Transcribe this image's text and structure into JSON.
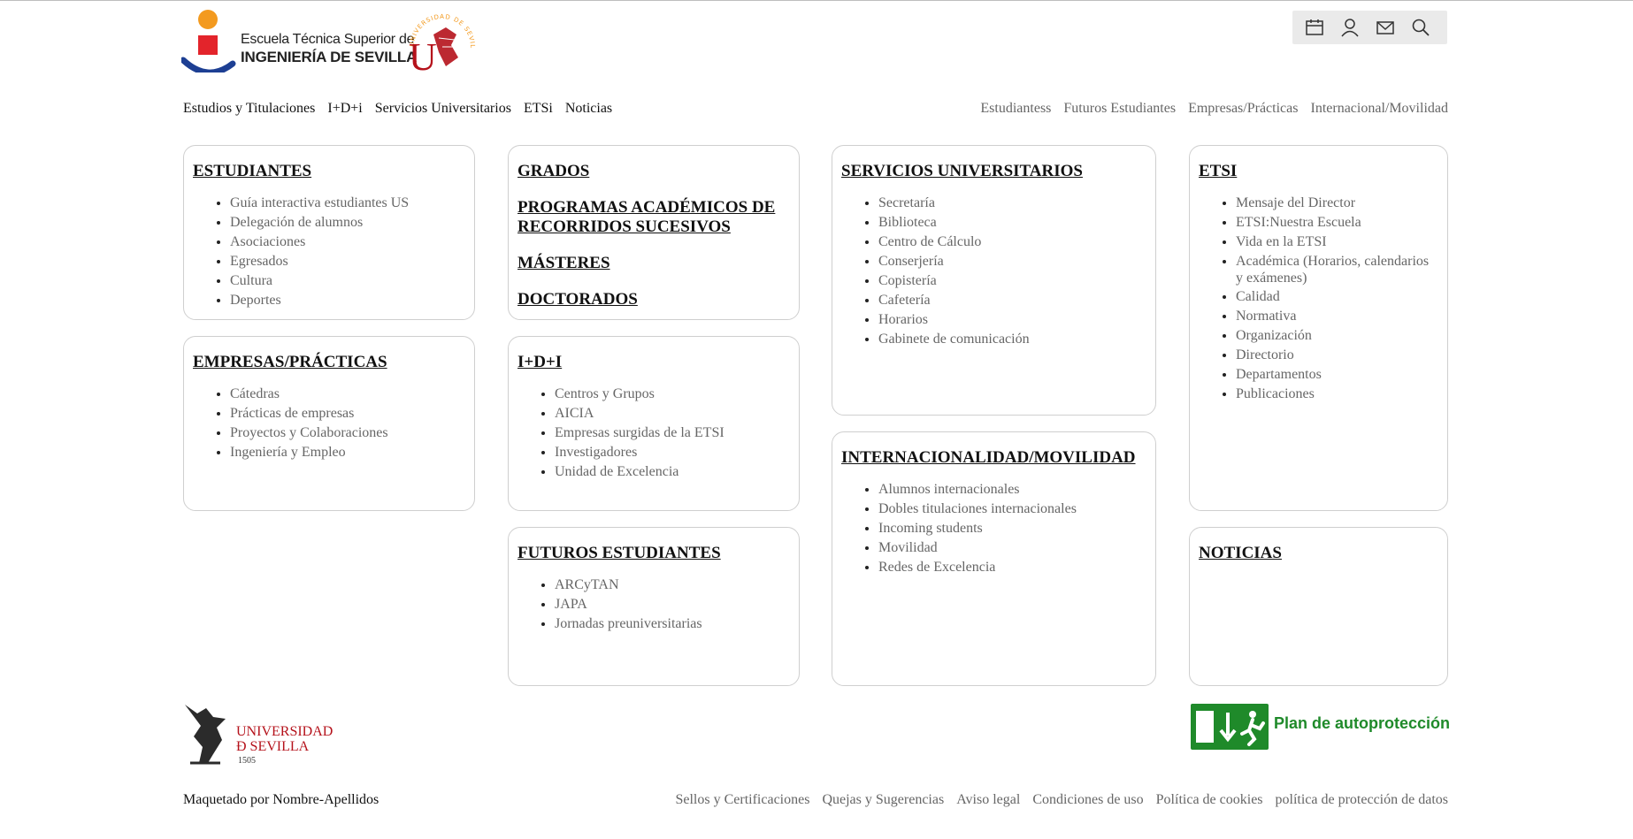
{
  "header": {
    "logo_line1": "Escuela Técnica Superior de",
    "logo_line2": "INGENIERÍA DE SEVILLA",
    "us_seal_text": "UNIVERSIDAD DE SEVILLA",
    "tools": [
      "calendar-icon",
      "user-icon",
      "mail-icon",
      "search-icon"
    ]
  },
  "nav": {
    "left": [
      "Estudios y Titulaciones",
      "I+D+i",
      "Servicios Universitarios",
      "ETSi",
      "Noticias"
    ],
    "right": [
      "Estudiantess",
      "Futuros Estudiantes",
      "Empresas/Prácticas",
      "Internacional/Movilidad"
    ]
  },
  "cards": {
    "estudiantes": {
      "title": "ESTUDIANTES",
      "items": [
        "Guía interactiva estudiantes US",
        "Delegación de alumnos",
        "Asociaciones",
        "Egresados",
        "Cultura",
        "Deportes"
      ]
    },
    "empresas": {
      "title": "EMPRESAS/PRÁCTICAS",
      "items": [
        "Cátedras",
        "Prácticas de empresas",
        "Proyectos y Colaboraciones",
        "Ingeniería y Empleo"
      ]
    },
    "estudios": {
      "headings": [
        "GRADOS",
        "PROGRAMAS ACADÉMICOS DE RECORRIDOS SUCESIVOS",
        "MÁSTERES",
        "DOCTORADOS"
      ]
    },
    "idi": {
      "title": "I+D+I",
      "items": [
        "Centros y Grupos",
        "AICIA",
        "Empresas surgidas de la ETSI",
        "Investigadores",
        "Unidad de Excelencia"
      ]
    },
    "futuros": {
      "title": "FUTUROS ESTUDIANTES",
      "items": [
        "ARCyTAN",
        "JAPA",
        "Jornadas preuniversitarias"
      ]
    },
    "servicios": {
      "title": "SERVICIOS UNIVERSITARIOS",
      "items": [
        "Secretaría",
        "Biblioteca",
        "Centro de Cálculo",
        "Conserjería",
        "Copistería",
        "Cafetería",
        "Horarios",
        "Gabinete de comunicación"
      ]
    },
    "internacional": {
      "title": "INTERNACIONALIDAD/MOVILIDAD",
      "items": [
        "Alumnos internacionales",
        "Dobles titulaciones internacionales",
        "Incoming students",
        "Movilidad",
        "Redes de Excelencia"
      ]
    },
    "etsi": {
      "title": "ETSI",
      "items": [
        "Mensaje del Director",
        "ETSI:Nuestra Escuela",
        "Vida en la ETSI",
        "Académica (Horarios, calendarios y exámenes)",
        "Calidad",
        "Normativa",
        "Organización",
        "Directorio",
        "Departamentos",
        "Publicaciones"
      ]
    },
    "noticias": {
      "title": "NOTICIAS"
    }
  },
  "footer": {
    "us_logo_line1": "UNIVERSIDAD",
    "us_logo_line2": "Ð SEVILLA",
    "us_logo_year": "1505",
    "plan_label": "Plan de autoprotección",
    "credit": "Maquetado por Nombre-Apellidos",
    "links": [
      "Sellos y Certificaciones",
      "Quejas y Sugerencias",
      "Aviso legal",
      "Condiciones de uso",
      "Política de cookies",
      "política de protección de datos"
    ]
  },
  "colors": {
    "etsi_orange": "#f39a1f",
    "etsi_red": "#e3242b",
    "etsi_blue": "#1d3f93",
    "us_red": "#b5121b",
    "exit_green": "#1f8a2a"
  }
}
